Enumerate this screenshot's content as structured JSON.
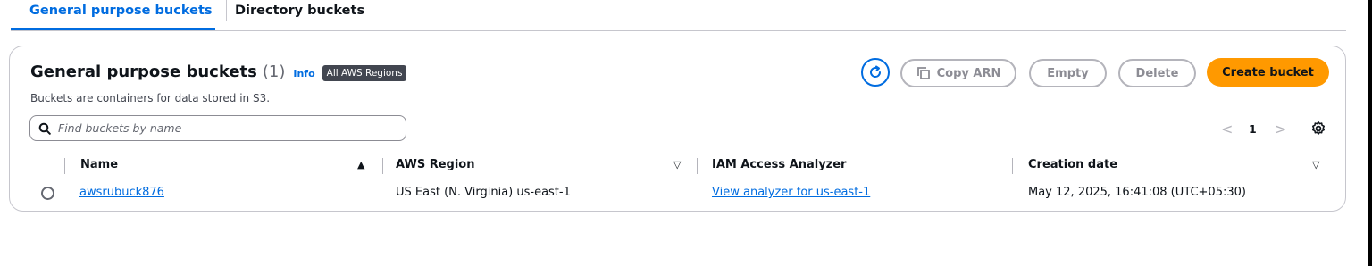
{
  "tabs": [
    {
      "label": "General purpose buckets",
      "active": true
    },
    {
      "label": "Directory buckets",
      "active": false
    }
  ],
  "header": {
    "title": "General purpose buckets",
    "count": "(1)",
    "info_link": "Info",
    "region_badge": "All AWS Regions",
    "description": "Buckets are containers for data stored in S3."
  },
  "actions": {
    "refresh_icon": "refresh-icon",
    "copy_arn": "Copy ARN",
    "copy_icon": "copy-icon",
    "empty": "Empty",
    "delete": "Delete",
    "create_bucket": "Create bucket"
  },
  "search": {
    "placeholder": "Find buckets by name",
    "value": "",
    "icon": "search-icon"
  },
  "pagination": {
    "prev": "<",
    "page": "1",
    "next": ">",
    "settings_icon": "gear-icon"
  },
  "table": {
    "columns": [
      {
        "label": "Name",
        "sort": "ascending"
      },
      {
        "label": "AWS Region",
        "sort": "none"
      },
      {
        "label": "IAM Access Analyzer",
        "sort": "none"
      },
      {
        "label": "Creation date",
        "sort": "none"
      }
    ],
    "rows": [
      {
        "selected": false,
        "name": "awsrubuck876",
        "region": "US East (N. Virginia) us-east-1",
        "analyzer": "View analyzer for us-east-1",
        "creation_date": "May 12, 2025, 16:41:08 (UTC+05:30)"
      }
    ]
  },
  "colors": {
    "accent": "#006ce0",
    "primary_button": "#ff9900",
    "badge_bg": "#424650",
    "disabled_border": "#b4b4bb"
  }
}
